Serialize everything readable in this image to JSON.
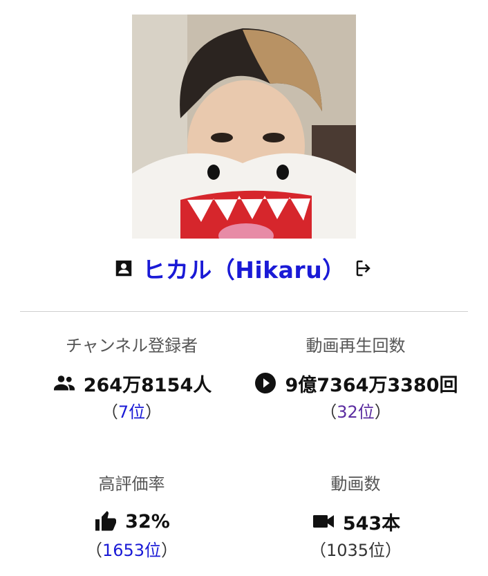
{
  "channel": {
    "name": "ヒカル（Hikaru）",
    "avatar": "profile-photo"
  },
  "icons": {
    "profile": "contact-card-icon",
    "external": "sign-in-icon",
    "subscribers": "people-icon",
    "views": "play-circle-icon",
    "rating": "thumbs-up-icon",
    "videos": "video-camera-icon"
  },
  "stats": {
    "subscribers": {
      "label": "チャンネル登録者",
      "value": "264万8154人",
      "rank_open": "（",
      "rank": "7位",
      "rank_close": "）"
    },
    "views": {
      "label": "動画再生回数",
      "value": "9億7364万3380回",
      "rank_open": "（",
      "rank": "32位",
      "rank_close": "）"
    },
    "rating": {
      "label": "高評価率",
      "value": "32%",
      "rank_open": "（",
      "rank": "1653位",
      "rank_close": "）"
    },
    "videos": {
      "label": "動画数",
      "value": "543本",
      "rank_text": "（1035位）"
    }
  },
  "colors": {
    "link": "#1a1ad6",
    "visited_link": "#5b2ca0",
    "divider": "#cfcfcf"
  }
}
